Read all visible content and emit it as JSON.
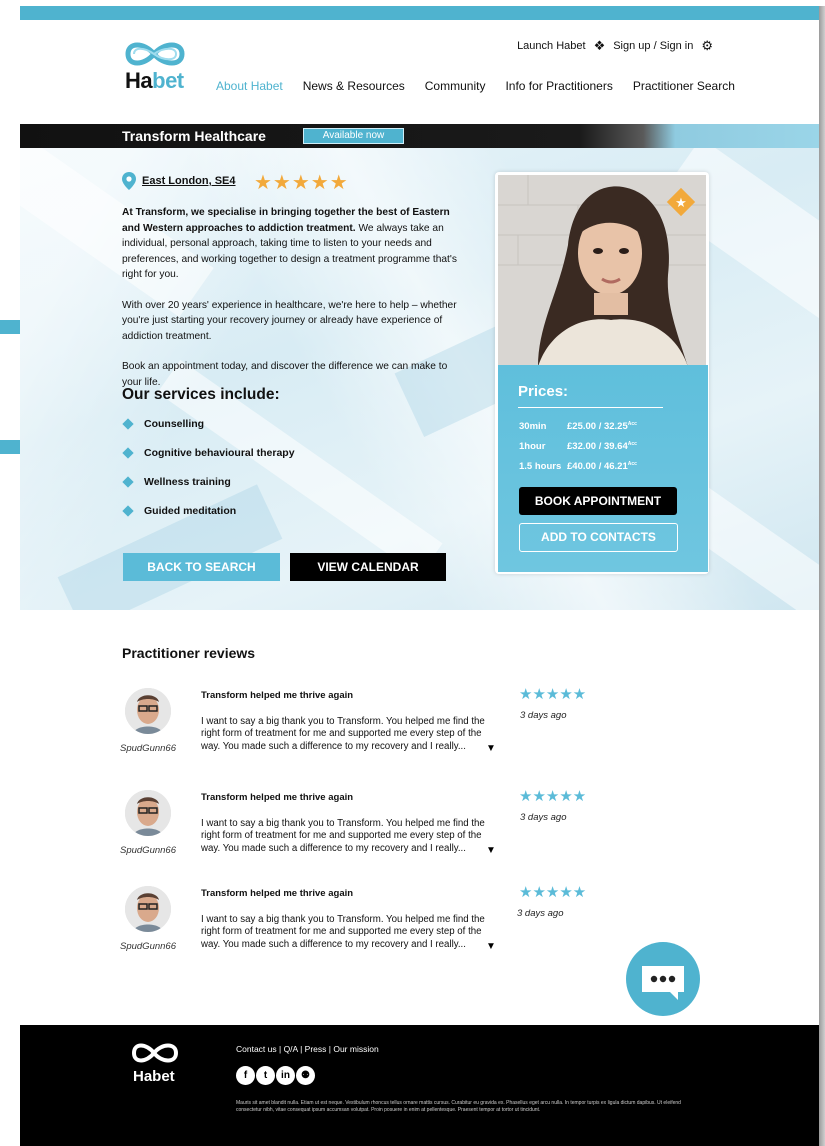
{
  "header": {
    "logo_text_a": "Ha",
    "logo_text_b": "bet",
    "launch_label": "Launch Habet",
    "signin_label": "Sign up / Sign in",
    "nav": [
      "About Habet",
      "News & Resources",
      "Community",
      "Info for Practitioners",
      "Practitioner Search"
    ],
    "active_nav": "About Habet"
  },
  "banner": {
    "title": "Transform Healthcare",
    "status": "Available now"
  },
  "practitioner": {
    "location": "East London, SE4",
    "rating": 5,
    "stars": "★★★★★",
    "desc_1_bold": "At Transform, we specialise in bringing together the best of Eastern and Western approaches to addiction treatment.",
    "desc_1_rest": " We always take an individual, personal approach, taking time to listen to your needs and preferences, and working together to design a treatment programme that's right for you.",
    "desc_2": "With over 20 years' experience in healthcare, we're here to help – whether you're just starting your recovery journey or already have experience of addiction treatment.",
    "desc_3": "Book an appointment today, and discover the difference we can make to your life.",
    "services_title": "Our services include:",
    "services": [
      "Counselling",
      "Cognitive behavioural therapy",
      "Wellness training",
      "Guided meditation"
    ],
    "back_label": "BACK TO SEARCH",
    "calendar_label": "VIEW CALENDAR"
  },
  "prices": {
    "title": "Prices:",
    "rows": [
      {
        "duration": "30min",
        "price": "£25.00 / 32.25",
        "sup": "Acc"
      },
      {
        "duration": "1hour",
        "price": "£32.00 / 39.64",
        "sup": "Acc"
      },
      {
        "duration": "1.5 hours",
        "price": "£40.00 / 46.21",
        "sup": "Acc"
      }
    ],
    "book_label": "BOOK APPOINTMENT",
    "add_label": "ADD TO CONTACTS"
  },
  "reviews": {
    "title": "Practitioner reviews",
    "items": [
      {
        "user": "SpudGunn66",
        "title": "Transform helped me thrive again",
        "body": "I want to say a big thank you to Transform. You helped me find the right form of treatment for me and supported me every step of the way. You made such a difference to my recovery and I really...",
        "stars": "★★★★★",
        "date": "3 days ago"
      },
      {
        "user": "SpudGunn66",
        "title": "Transform helped me thrive again",
        "body": "I want to say a big thank you to Transform. You helped me find the right form of treatment for me and supported me every step of the way. You made such a difference to my recovery and I really...",
        "stars": "★★★★★",
        "date": "3 days ago"
      },
      {
        "user": "SpudGunn66",
        "title": "Transform helped me thrive again",
        "body": "I want to say a big thank you to Transform. You helped me find the right form of treatment for me and supported me every step of the way. You made such a difference to my recovery and I really...",
        "stars": "★★★★★",
        "date": "3 days ago"
      }
    ]
  },
  "footer": {
    "logo_text": "Habet",
    "links": "Contact us  |  Q/A  |  Press  |  Our mission",
    "social": [
      "f",
      "t",
      "in",
      "⚉"
    ],
    "legal": "Mauris sit amet blandit nulla. Etiam ut est neque. Vestibulum rhoncus tellus ornare mattis cursus. Curabitur eu gravida ex. Phasellus eget arcu nulla. In tempor turpis ex ligula dictum dapibus. Ut eleifend consectetur nibh, vitae consequat ipsum accumsan volutpat. Proin posuere in enim at pellentesque. Praesent tempor at tortor ut tincidunt."
  },
  "colors": {
    "accent": "#4fb3cf",
    "star_gold": "#f2a93b",
    "dark": "#000000"
  }
}
